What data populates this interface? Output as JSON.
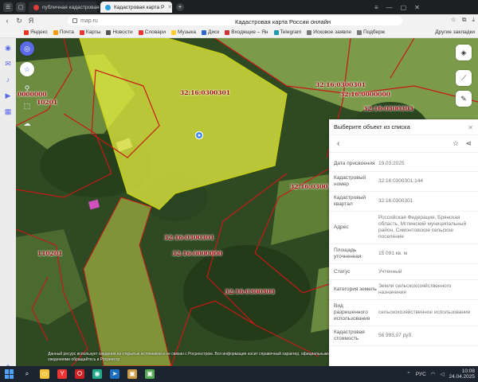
{
  "browser": {
    "tabs": [
      {
        "label": "публичная кадастровая",
        "active": false
      },
      {
        "label": "Кадастровая карта Р",
        "active": true
      }
    ],
    "url": "map.ru",
    "page_title": "Кадастровая карта России онлайн",
    "bookmarks": [
      {
        "label": "Яндекс",
        "color": "#e32"
      },
      {
        "label": "Почта",
        "color": "#f90"
      },
      {
        "label": "Карты",
        "color": "#e33"
      },
      {
        "label": "Новости",
        "color": "#555"
      },
      {
        "label": "Словари",
        "color": "#e33"
      },
      {
        "label": "Музыка",
        "color": "#fc3"
      },
      {
        "label": "Диск",
        "color": "#36c"
      },
      {
        "label": "Входящие – Ян",
        "color": "#c33"
      },
      {
        "label": "Telegram",
        "color": "#29a"
      },
      {
        "label": "Исковое заявле",
        "color": "#777"
      },
      {
        "label": "Подберж",
        "color": "#777"
      }
    ],
    "other_bookmarks": "Другие закладки"
  },
  "map": {
    "labels": [
      {
        "text": "32:16:0300301",
        "id": "lbl1"
      },
      {
        "text": "32:16:0000000",
        "id": "lbl2"
      },
      {
        "text": "32:16:0300303",
        "id": "lbl3"
      },
      {
        "text": "32:16:0000000",
        "id": "lbl4"
      },
      {
        "text": "32:16:0300301",
        "id": "lbl5"
      },
      {
        "text": "32:16:0300301",
        "id": "lbl6"
      },
      {
        "text": "32:16:0000000",
        "id": "lbl7"
      },
      {
        "text": "32:16:0300303",
        "id": "lbl8"
      },
      {
        "text": "0000000",
        "id": "lbl9"
      },
      {
        "text": "10201",
        "id": "lbl10"
      },
      {
        "text": "110201",
        "id": "lbl11"
      },
      {
        "text": "32:16:0300301",
        "id": "lbl12"
      }
    ],
    "disclaimer": "Данный ресурс использует сведения из открытых источников и не связан с Росреестром. Вся информация носит справочный характер, официальными сведениями обращайтесь в Росреестр"
  },
  "panel": {
    "header": "Выберите объект из списка",
    "fields": [
      {
        "key": "Дата присвоения",
        "value": "19.03.2025"
      },
      {
        "key": "Кадастровый номер",
        "value": "32:16:0300301:144"
      },
      {
        "key": "Кадастровый квартал",
        "value": "32:16:0300301"
      },
      {
        "key": "Адрес",
        "value": "Российская Федерация, Брянская область, Мглинский муниципальный район, Симонтовское сельское поселение"
      },
      {
        "key": "Площадь уточненная",
        "value": "15 091 кв. м"
      },
      {
        "key": "Статус",
        "value": "Учтенный"
      },
      {
        "key": "Категория земель",
        "value": "Земли сельскохозяйственного назначения"
      },
      {
        "key": "Вид разрешенного использования",
        "value": "сельскохозяйственное использование"
      },
      {
        "key": "Кадастровая стоимость",
        "value": "56 993,07 руб."
      }
    ]
  },
  "taskbar": {
    "lang": "РУС",
    "time": "10:08",
    "date": "24.04.2025"
  },
  "colors": {
    "accent": "#5b6be8",
    "parcel_fill": "#e8f040",
    "boundary": "#c81818"
  }
}
